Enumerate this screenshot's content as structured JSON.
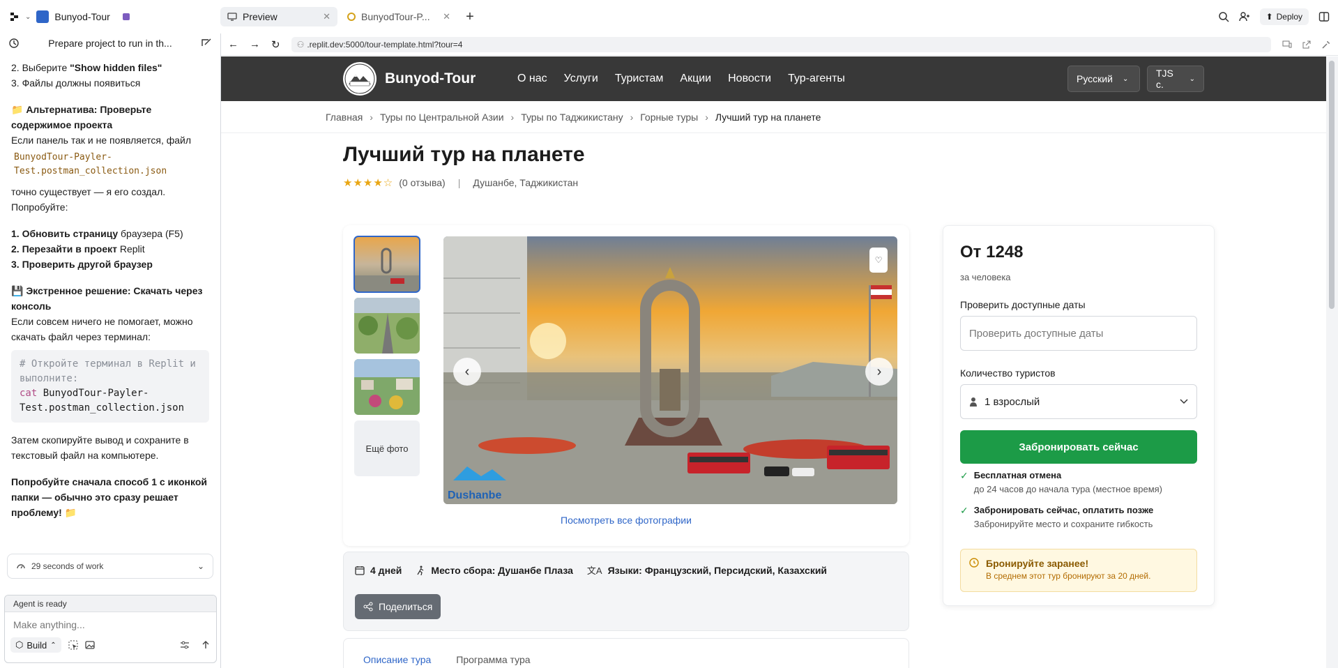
{
  "topbar": {
    "project_name": "Bunyod-Tour",
    "tabs": [
      {
        "label": "Preview",
        "active": true
      },
      {
        "label": "BunyodTour-P...",
        "active": false
      }
    ],
    "deploy_label": "Deploy"
  },
  "sidebar": {
    "title": "Prepare project to run in th...",
    "chat": {
      "l1_pre": "2. Выберите ",
      "l1_bold": "\"Show hidden files\"",
      "l2": "3. Файлы должны появиться",
      "alt_heading": "📁 Альтернатива: Проверьте содержимое проекта",
      "alt_text1": "Если панель так и не появляется, файл",
      "file_code": "BunyodTour-Payler-Test.postman_collection.json",
      "alt_text2": "точно существует — я его создал. Попробуйте:",
      "s1_bold": "1. Обновить страницу",
      "s1_rest": " браузера (F5)",
      "s2_bold": "2. Перезайти в проект",
      "s2_rest": " Replit",
      "s3_bold": "3. Проверить другой браузер",
      "emerg_heading": "💾 Экстренное решение: Скачать через консоль",
      "emerg_text": "Если совсем ничего не помогает, можно скачать файл через терминал:",
      "code_comment": "# Откройте терминал в Replit и выполните:",
      "code_cmd": "cat",
      "code_arg": " BunyodTour-Payler-Test.postman_collection.json",
      "after_code": "Затем скопируйте вывод и сохраните в текстовый файл на компьютере.",
      "final_bold": "Попробуйте сначала способ 1 с иконкой папки — обычно это сразу решает проблему! 📁"
    },
    "work_label": "29 seconds of work",
    "agent_status": "Agent is ready",
    "input_placeholder": "Make anything...",
    "build_label": "Build"
  },
  "browser": {
    "url": ".replit.dev:5000/tour-template.html?tour=4"
  },
  "site": {
    "brand": "Bunyod-Tour",
    "nav": [
      "О нас",
      "Услуги",
      "Туристам",
      "Акции",
      "Новости",
      "Тур-агенты"
    ],
    "language": "Русский",
    "currency": "TJS с.",
    "breadcrumbs": [
      "Главная",
      "Туры по Центральной Азии",
      "Туры по Таджикистану",
      "Горные туры",
      "Лучший тур на планете"
    ],
    "title": "Лучший тур на планете",
    "rating_stars": 4.5,
    "reviews": "(0 отзыва)",
    "location": "Душанбе, Таджикистан",
    "more_photos": "Ещё фото",
    "view_all_photos": "Посмотреть все фотографии",
    "duration": "4 дней",
    "meeting_point": "Место сбора: Душанбе Плаза",
    "languages": "Языки: Французский, Персидский, Казахский",
    "share": "Поделиться",
    "content_tabs": [
      "Описание тура",
      "Программа тура"
    ],
    "image_watermark": "Dushanbe"
  },
  "booking": {
    "price": "От 1248",
    "per_person": "за человека",
    "dates_label": "Проверить доступные даты",
    "dates_placeholder": "Проверить доступные даты",
    "tourists_label": "Количество туристов",
    "tourists_value": "1 взрослый",
    "book_button": "Забронировать сейчас",
    "feature1_title": "Бесплатная отмена",
    "feature1_sub": "до 24 часов до начала тура (местное время)",
    "feature2_title": "Забронировать сейчас, оплатить позже",
    "feature2_sub": "Забронируйте место и сохраните гибкость",
    "notice_title": "Бронируйте заранее!",
    "notice_sub": "В среднем этот тур бронируют за 20 дней."
  },
  "colors": {
    "nav_bg": "#383838",
    "book_green": "#1c9b47",
    "link_blue": "#2f66c8",
    "notice_bg": "#fff8e1"
  }
}
